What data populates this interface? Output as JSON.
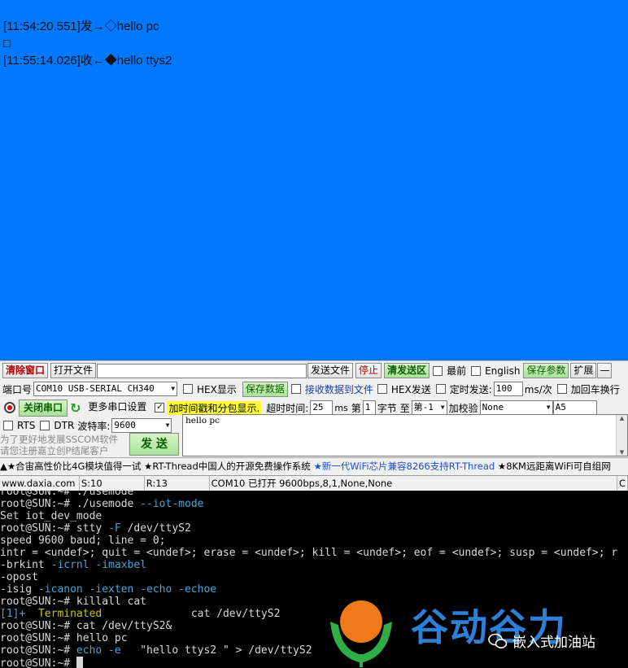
{
  "receive": {
    "lines": [
      "[11:54:20.551]发→◇hello pc",
      "□",
      "[11:55:14.026]收←◆hello ttys2"
    ]
  },
  "toolbar": {
    "clear_window": "清除窗口",
    "open_file": "打开文件",
    "file_path": "",
    "send_file": "发送文件",
    "stop": "停止",
    "clear_send": "清发送区",
    "topmost": "最前",
    "english": "English",
    "save_params": "保存参数",
    "expand": "扩展",
    "collapse": "—"
  },
  "config": {
    "port_label": "端口号",
    "port_value": "COM10 USB-SERIAL CH340",
    "hex_display": "HEX显示",
    "save_data": "保存数据",
    "recv_to_file": "接收数据到文件",
    "hex_send": "HEX发送",
    "timed_send": "定时发送:",
    "timed_ms": "100",
    "ms_per": "ms/次",
    "add_crlf": "加回车换行",
    "close_port": "关闭串口",
    "more_settings": "更多串口设置",
    "timestamp_label": "加时间戳和分包显示.",
    "timeout_label": "超时时间:",
    "timeout_value": "25",
    "ms": "ms",
    "byte_no_label": "第",
    "byte_no_value": "1",
    "byte_to_label": "字节 至",
    "byte_to_value": "第-1",
    "checksum_label": "加校验",
    "checksum_value": "None",
    "extra_value": "A5",
    "rts": "RTS",
    "dtr": "DTR",
    "baud_label": "波特率:",
    "baud_value": "9600",
    "send_text": "hello pc",
    "promo_line1": "为了更好地发展SSCOM软件",
    "promo_line2": "请您注册嘉立创P结尾客户",
    "send_button": "发  送"
  },
  "marquee": {
    "part1": "▲★合宙高性价比4G模块值得一试 ★RT-Thread中国人的开源免费操作系统 ",
    "part2": "★新一代WiFi芯片兼容8266支持RT-Thread",
    "part3": " ★8KM远距离WiFi可自组网"
  },
  "status": {
    "site": "www.daxia.com",
    "sent": "S:10",
    "received": "R:13",
    "port_status": "COM10 已打开  9600bps,8,1,None,None",
    "tail": "C"
  },
  "terminal": {
    "lines": [
      [
        {
          "t": "root@SUN:~# ./usemode",
          "c": "c-gray"
        }
      ],
      [
        {
          "t": "root@SUN:~# ",
          "c": "c-gray"
        },
        {
          "t": "./usemode ",
          "c": "c-gray"
        },
        {
          "t": "--iot-mode",
          "c": "c-cyan"
        }
      ],
      [
        {
          "t": "Set iot_dev_mode",
          "c": "c-gray"
        }
      ],
      [
        {
          "t": "root@SUN:~# stty ",
          "c": "c-gray"
        },
        {
          "t": "-F",
          "c": "c-cyan"
        },
        {
          "t": " /dev/ttyS2",
          "c": "c-gray"
        }
      ],
      [
        {
          "t": "speed 9600 baud; line = 0;",
          "c": "c-gray"
        }
      ],
      [
        {
          "t": "intr = <undef>; quit = <undef>; erase = <undef>; kill = <undef>; eof = <undef>; susp = <undef>; r",
          "c": "c-gray"
        }
      ],
      [
        {
          "t": "-brkint ",
          "c": "c-gray"
        },
        {
          "t": "-icrnl -imaxbel",
          "c": "c-cyan"
        }
      ],
      [
        {
          "t": "-opost",
          "c": "c-gray"
        }
      ],
      [
        {
          "t": "-isig ",
          "c": "c-gray"
        },
        {
          "t": "-icanon -iexten -echo -echoe",
          "c": "c-cyan"
        }
      ],
      [
        {
          "t": "root@SUN:~# killall cat",
          "c": "c-gray"
        }
      ],
      [
        {
          "t": "[1]+  ",
          "c": "c-cyan"
        },
        {
          "t": "Terminated",
          "c": "c-yellow"
        },
        {
          "t": "              cat /dev/ttyS2",
          "c": "c-gray"
        }
      ],
      [
        {
          "t": "root@SUN:~# cat /dev/ttyS2&",
          "c": "c-gray"
        }
      ],
      [
        {
          "t": "root@SUN:~# hello pc",
          "c": "c-gray"
        }
      ],
      [
        {
          "t": "root@SUN:~# ",
          "c": "c-gray"
        },
        {
          "t": "echo -e",
          "c": "c-cyan"
        },
        {
          "t": "   \"hello ttys2 \" > /dev/ttyS2",
          "c": "c-gray"
        }
      ],
      [
        {
          "t": "root@SUN:~# ",
          "c": "c-gray"
        }
      ]
    ]
  },
  "watermark": {
    "title": "谷动谷力",
    "subtitle": "嵌入式加油站"
  },
  "colors": {
    "receive_bg": "#0078ff",
    "timestamp_highlight": "#ffff33",
    "terminal_cyan": "#49a3d6",
    "terminal_yellow": "#c8c600",
    "logo_orange": "#f07a1a",
    "logo_green": "#2fae45",
    "title_blue": "#2f7fd6"
  }
}
